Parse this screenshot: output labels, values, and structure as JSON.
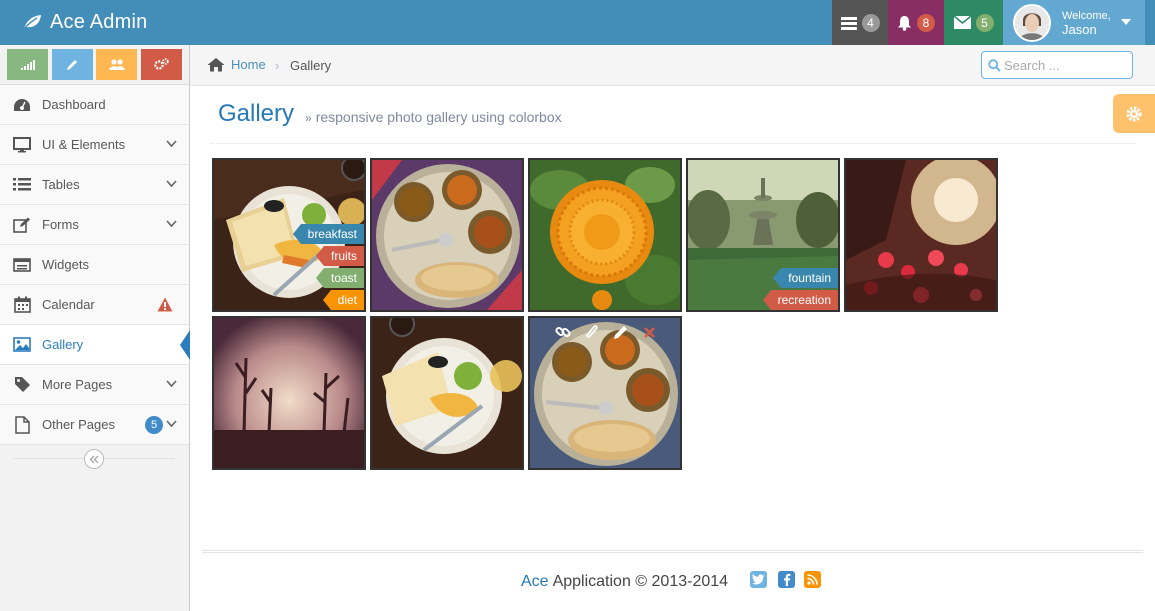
{
  "navbar": {
    "brand": "Ace Admin",
    "tiles": [
      {
        "name": "tasks",
        "count": "4",
        "bg": "#555555",
        "badge": "#999999"
      },
      {
        "name": "notifications",
        "count": "8",
        "bg": "#892e65",
        "badge": "#d15b47"
      },
      {
        "name": "messages",
        "count": "5",
        "bg": "#2e8965",
        "badge": "#82af6f"
      }
    ],
    "user": {
      "welcome": "Welcome,",
      "name": "Jason"
    }
  },
  "sidebar": {
    "items": [
      {
        "label": "Dashboard",
        "icon": "dashboard-icon"
      },
      {
        "label": "UI & Elements",
        "icon": "desktop-icon"
      },
      {
        "label": "Tables",
        "icon": "list-icon"
      },
      {
        "label": "Forms",
        "icon": "pencil-square-icon"
      },
      {
        "label": "Widgets",
        "icon": "widgets-icon"
      },
      {
        "label": "Calendar",
        "icon": "calendar-icon"
      },
      {
        "label": "Gallery",
        "icon": "picture-icon"
      },
      {
        "label": "More Pages",
        "icon": "tag-icon"
      },
      {
        "label": "Other Pages",
        "icon": "file-icon",
        "badge": "5"
      }
    ]
  },
  "breadcrumb": {
    "home": "Home",
    "current": "Gallery"
  },
  "search": {
    "placeholder": "Search ..."
  },
  "page": {
    "title": "Gallery",
    "subtitle": "responsive photo gallery using colorbox"
  },
  "gallery": {
    "tags_first": [
      "breakfast",
      "fruits",
      "toast",
      "diet"
    ],
    "tags_fourth": [
      "fountain",
      "recreation"
    ]
  },
  "footer": {
    "brand": "Ace",
    "text": "Application © 2013-2014"
  },
  "colors": {
    "navbar": "#438eb9",
    "accent": "#2679b5",
    "active": "#2b7dbc"
  }
}
